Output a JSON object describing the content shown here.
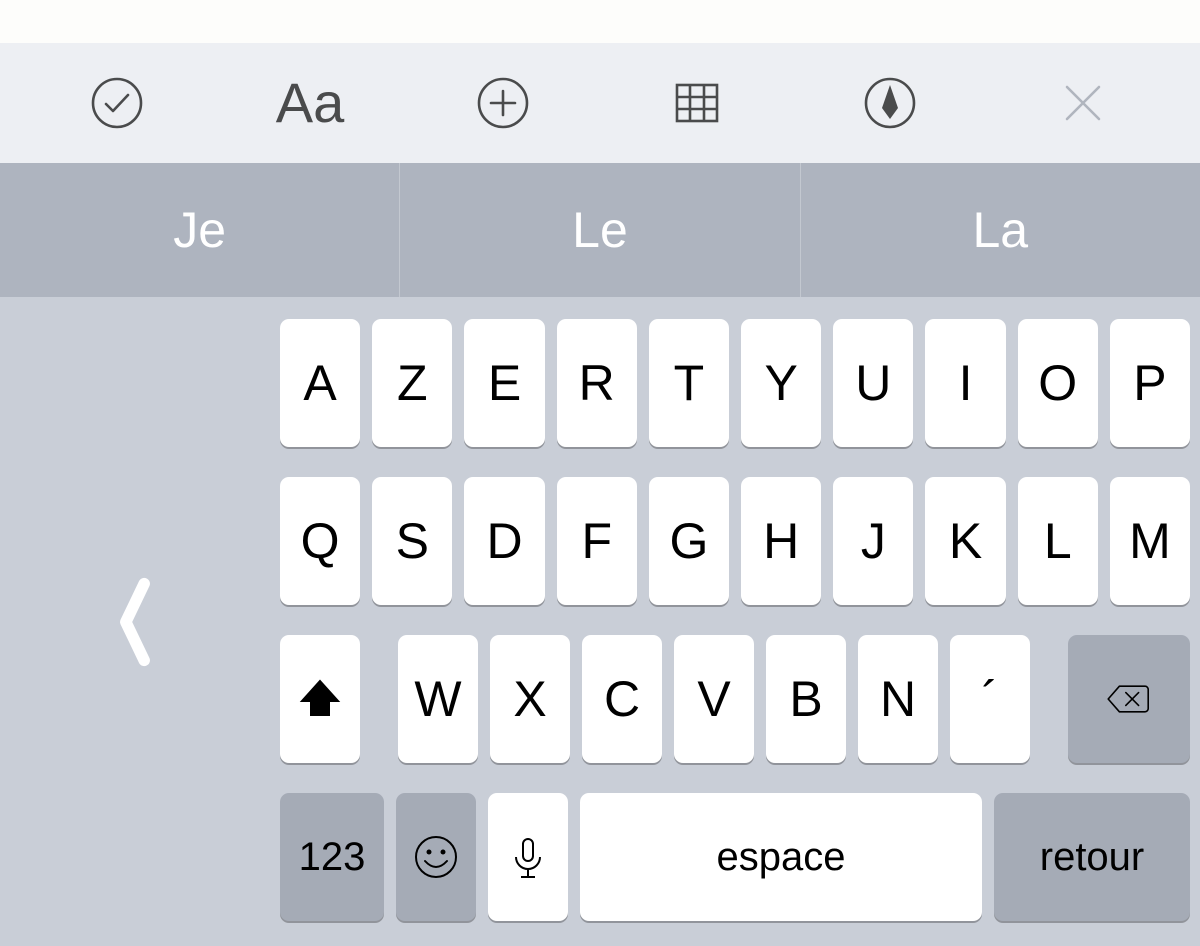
{
  "toolbar": {
    "aa_label": "Aa"
  },
  "predictive": [
    "Je",
    "Le",
    "La"
  ],
  "keyboard": {
    "row1": [
      "A",
      "Z",
      "E",
      "R",
      "T",
      "Y",
      "U",
      "I",
      "O",
      "P"
    ],
    "row2": [
      "Q",
      "S",
      "D",
      "F",
      "G",
      "H",
      "J",
      "K",
      "L",
      "M"
    ],
    "row3_letters": [
      "W",
      "X",
      "C",
      "V",
      "B",
      "N",
      "´"
    ],
    "num_key": "123",
    "space": "espace",
    "return": "retour"
  }
}
